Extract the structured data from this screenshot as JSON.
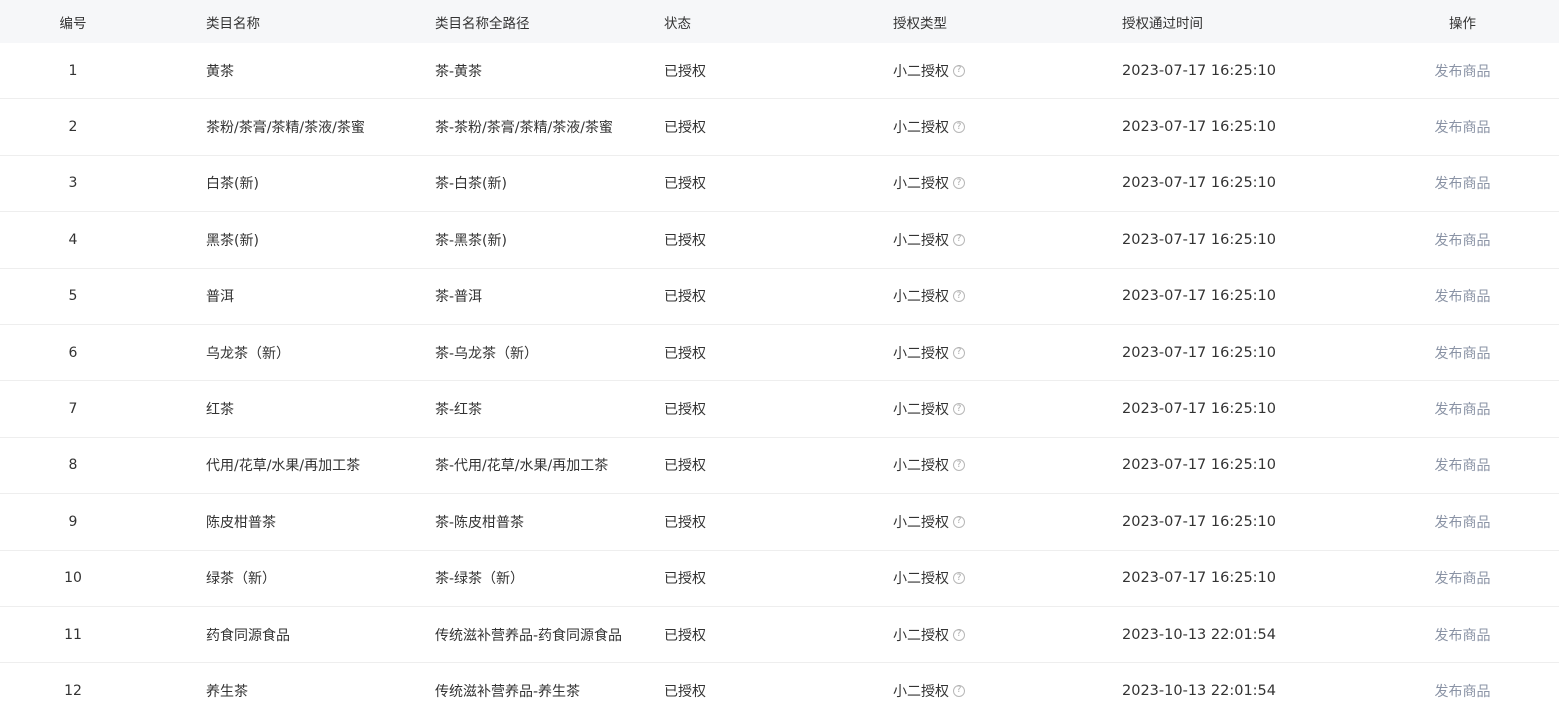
{
  "columns": {
    "no": "编号",
    "name": "类目名称",
    "path": "类目名称全路径",
    "status": "状态",
    "type": "授权类型",
    "time": "授权通过时间",
    "op": "操作"
  },
  "help_icon_glyph": "?",
  "rows": [
    {
      "no": "1",
      "name": "黄茶",
      "path": "茶-黄茶",
      "status": "已授权",
      "type": "小二授权",
      "time": "2023-07-17 16:25:10",
      "op": "发布商品"
    },
    {
      "no": "2",
      "name": "茶粉/茶膏/茶精/茶液/茶蜜",
      "path": "茶-茶粉/茶膏/茶精/茶液/茶蜜",
      "status": "已授权",
      "type": "小二授权",
      "time": "2023-07-17 16:25:10",
      "op": "发布商品"
    },
    {
      "no": "3",
      "name": "白茶(新)",
      "path": "茶-白茶(新)",
      "status": "已授权",
      "type": "小二授权",
      "time": "2023-07-17 16:25:10",
      "op": "发布商品"
    },
    {
      "no": "4",
      "name": "黑茶(新)",
      "path": "茶-黑茶(新)",
      "status": "已授权",
      "type": "小二授权",
      "time": "2023-07-17 16:25:10",
      "op": "发布商品"
    },
    {
      "no": "5",
      "name": "普洱",
      "path": "茶-普洱",
      "status": "已授权",
      "type": "小二授权",
      "time": "2023-07-17 16:25:10",
      "op": "发布商品"
    },
    {
      "no": "6",
      "name": "乌龙茶（新）",
      "path": "茶-乌龙茶（新）",
      "status": "已授权",
      "type": "小二授权",
      "time": "2023-07-17 16:25:10",
      "op": "发布商品"
    },
    {
      "no": "7",
      "name": "红茶",
      "path": "茶-红茶",
      "status": "已授权",
      "type": "小二授权",
      "time": "2023-07-17 16:25:10",
      "op": "发布商品"
    },
    {
      "no": "8",
      "name": "代用/花草/水果/再加工茶",
      "path": "茶-代用/花草/水果/再加工茶",
      "status": "已授权",
      "type": "小二授权",
      "time": "2023-07-17 16:25:10",
      "op": "发布商品"
    },
    {
      "no": "9",
      "name": "陈皮柑普茶",
      "path": "茶-陈皮柑普茶",
      "status": "已授权",
      "type": "小二授权",
      "time": "2023-07-17 16:25:10",
      "op": "发布商品"
    },
    {
      "no": "10",
      "name": "绿茶（新）",
      "path": "茶-绿茶（新）",
      "status": "已授权",
      "type": "小二授权",
      "time": "2023-07-17 16:25:10",
      "op": "发布商品"
    },
    {
      "no": "11",
      "name": "药食同源食品",
      "path": "传统滋补营养品-药食同源食品",
      "status": "已授权",
      "type": "小二授权",
      "time": "2023-10-13 22:01:54",
      "op": "发布商品"
    },
    {
      "no": "12",
      "name": "养生茶",
      "path": "传统滋补营养品-养生茶",
      "status": "已授权",
      "type": "小二授权",
      "time": "2023-10-13 22:01:54",
      "op": "发布商品"
    }
  ]
}
